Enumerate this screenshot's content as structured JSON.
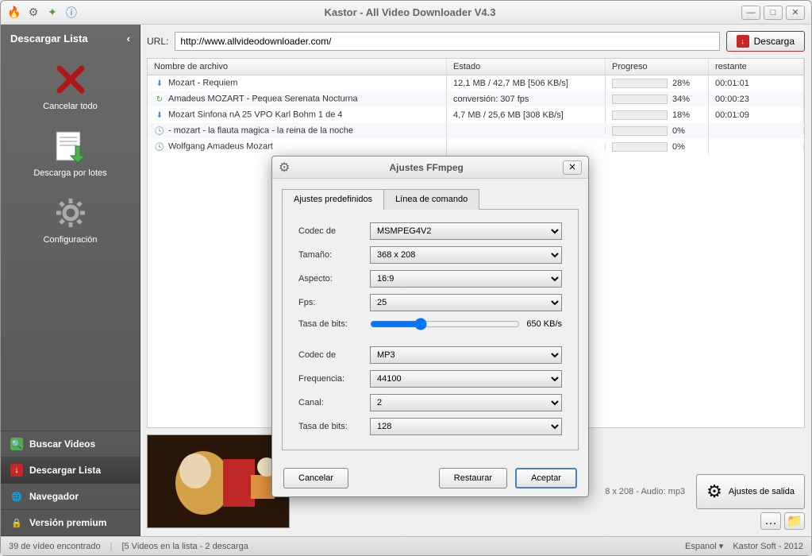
{
  "window": {
    "title": "Kastor - All Video Downloader V4.3"
  },
  "sidebar": {
    "header": "Descargar Lista",
    "items": [
      {
        "label": "Cancelar todo"
      },
      {
        "label": "Descarga por lotes"
      },
      {
        "label": "Configuración"
      }
    ],
    "nav": [
      {
        "label": "Buscar Videos"
      },
      {
        "label": "Descargar Lista"
      },
      {
        "label": "Navegador"
      },
      {
        "label": "Versión premium"
      }
    ]
  },
  "url": {
    "label": "URL:",
    "value": "http://www.allvideodownloader.com/",
    "button": "Descarga"
  },
  "table": {
    "headers": {
      "name": "Nombre de archivo",
      "status": "Estado",
      "progress": "Progreso",
      "remaining": "restante"
    },
    "rows": [
      {
        "icon": "download",
        "name": "Mozart - Requiem",
        "status": "12,1 MB / 42,7 MB [506 KB/s]",
        "progress": 28,
        "progress_text": "28%",
        "remaining": "00:01:01"
      },
      {
        "icon": "convert",
        "name": "Amadeus MOZART - Pequea Serenata Nocturna",
        "status": "conversión: 307 fps",
        "progress": 34,
        "progress_text": "34%",
        "remaining": "00:00:23"
      },
      {
        "icon": "download",
        "name": "Mozart Sinfona nA 25 VPO Karl Bohm 1 de 4",
        "status": "4,7 MB / 25,6 MB [308 KB/s]",
        "progress": 18,
        "progress_text": "18%",
        "remaining": "00:01:09"
      },
      {
        "icon": "clock",
        "name": "- mozart - la flauta magica - la reina de la noche",
        "status": "",
        "progress": 0,
        "progress_text": "0%",
        "remaining": ""
      },
      {
        "icon": "clock",
        "name": "Wolfgang Amadeus Mozart",
        "status": "",
        "progress": 0,
        "progress_text": "0%",
        "remaining": ""
      }
    ]
  },
  "output": {
    "info": "8 x 208 - Audio: mp3",
    "settings_button": "Ajustes de salida"
  },
  "statusbar": {
    "found": "39 de vídeo encontrado",
    "queue": "[5 Videos en la lista - 2 descarga",
    "lang": "Espanol",
    "credit": "Kastor Soft - 2012"
  },
  "dialog": {
    "title": "Ajustes FFmpeg",
    "tabs": {
      "presets": "Ajustes predefinidos",
      "cmdline": "Línea de comando"
    },
    "video": {
      "codec_label": "Codec de",
      "codec_value": "MSMPEG4V2",
      "size_label": "Tamaño:",
      "size_value": "368 x 208",
      "aspect_label": "Aspecto:",
      "aspect_value": "16:9",
      "fps_label": "Fps:",
      "fps_value": "25",
      "bitrate_label": "Tasa de bits:",
      "bitrate_value": "650 KB/s"
    },
    "audio": {
      "codec_label": "Codec de",
      "codec_value": "MP3",
      "freq_label": "Frequencia:",
      "freq_value": "44100",
      "channel_label": "Canal:",
      "channel_value": "2",
      "bitrate_label": "Tasa de bits:",
      "bitrate_value": "128"
    },
    "buttons": {
      "cancel": "Cancelar",
      "restore": "Restaurar",
      "accept": "Aceptar"
    }
  }
}
